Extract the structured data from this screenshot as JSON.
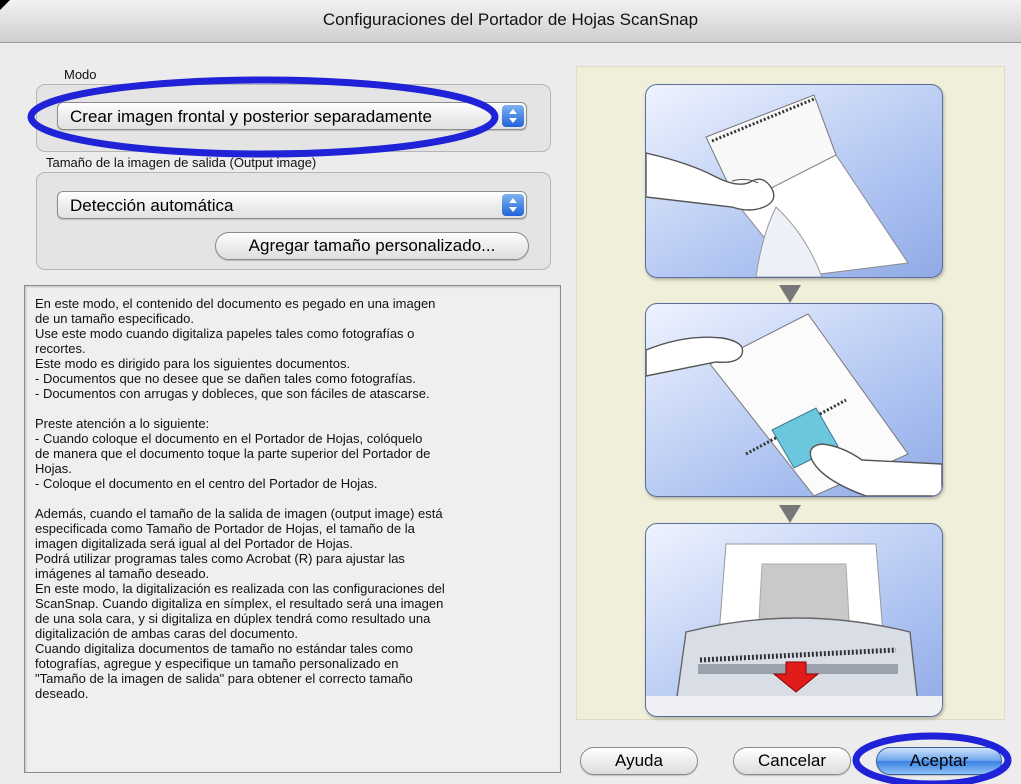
{
  "window": {
    "title": "Configuraciones del Portador de Hojas ScanSnap"
  },
  "mode": {
    "label": "Modo",
    "selected": "Crear imagen frontal y posterior separadamente"
  },
  "output_size": {
    "label": "Tamaño de la imagen de salida (Output image)",
    "selected": "Detección automática",
    "add_custom_button": "Agregar tamaño personalizado..."
  },
  "description": {
    "lines": [
      "En este modo, el contenido del documento es pegado en una imagen",
      "de un tamaño especificado.",
      "Use este modo cuando digitaliza papeles tales como fotografías o",
      "recortes.",
      "Este modo es dirigido para los siguientes documentos.",
      " - Documentos que no desee que se dañen tales como fotografías.",
      " - Documentos con arrugas y dobleces, que son fáciles de atascarse.",
      "",
      "Preste atención a lo siguiente:",
      " - Cuando coloque el documento en el Portador de Hojas,  colóquelo",
      "de manera que el documento toque  la parte superior del Portador de",
      "Hojas.",
      " - Coloque el documento en el centro del Portador de Hojas.",
      "",
      "Además, cuando el tamaño de la salida de imagen (output image) está",
      "especificada como Tamaño de Portador de Hojas, el tamaño de la",
      "imagen digitalizada será igual al del Portador de Hojas.",
      "Podrá utilizar programas tales como Acrobat (R) para ajustar las",
      "imágenes al tamaño deseado.",
      "En este modo, la digitalización es realizada con las configuraciones del",
      "ScanSnap. Cuando digitaliza en símplex, el resultado será una imagen",
      "de una sola cara, y si digitaliza en dúplex tendrá como resultado una",
      "digitalización de ambas caras del documento.",
      "Cuando digitaliza documentos de tamaño no estándar tales como",
      "fotografías, agregue y especifique un tamaño personalizado en",
      "\"Tamaño de la imagen de salida\" para obtener el correcto tamaño",
      "deseado."
    ]
  },
  "buttons": {
    "help": "Ayuda",
    "cancel": "Cancelar",
    "ok": "Aceptar"
  },
  "colors": {
    "annotation": "#1f22d6",
    "default_button": "#3c82e4",
    "illustration_background": "#f0efd9",
    "frame_background": "#a9bff0"
  }
}
